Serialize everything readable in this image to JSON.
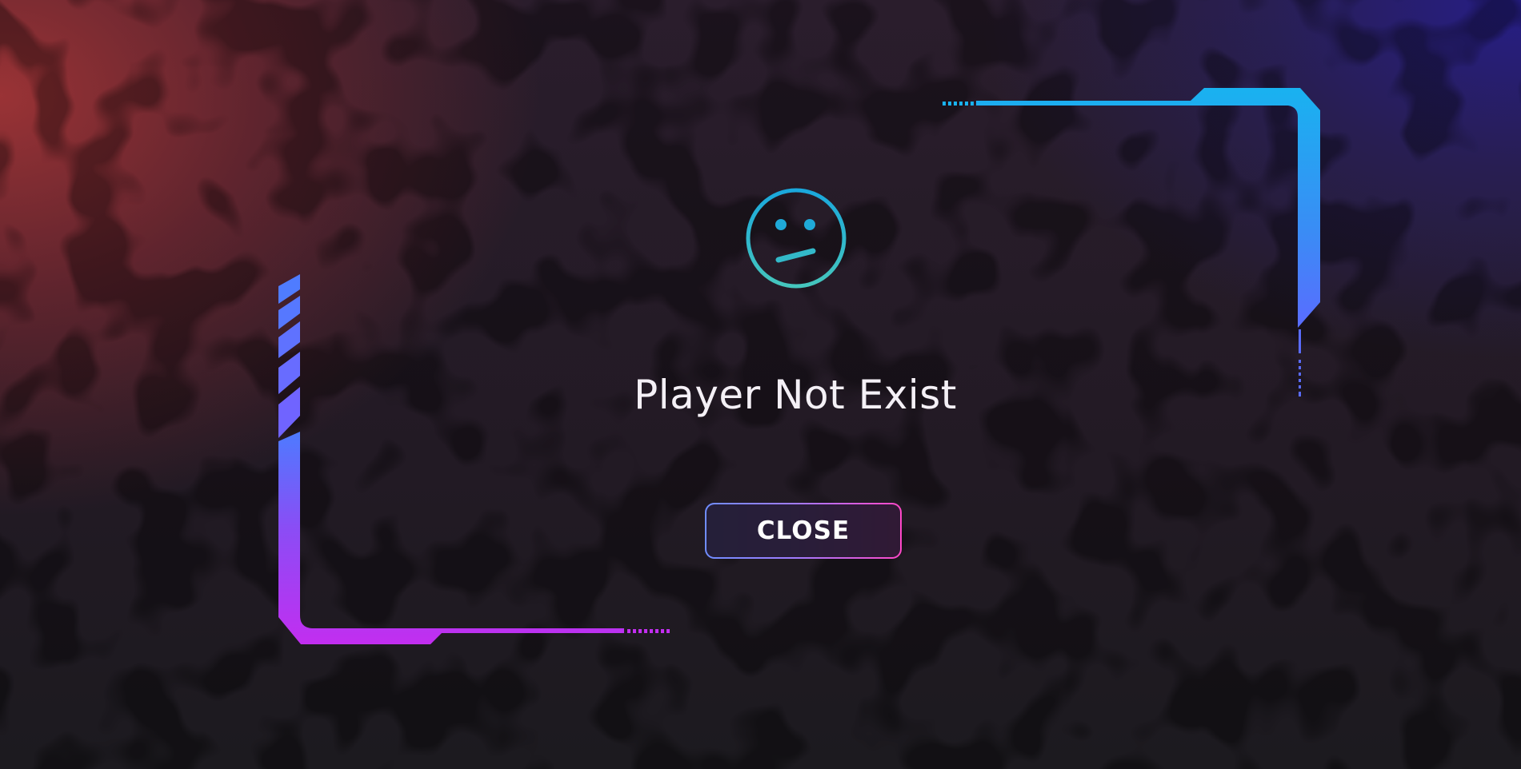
{
  "dialog": {
    "message": "Player Not Exist",
    "close_label": "CLOSE",
    "icon": "neutral-face-icon"
  },
  "colors": {
    "accent_cyan": "#1bb0f0",
    "accent_blue": "#4d7bff",
    "accent_purple": "#c02ef0",
    "accent_magenta": "#ff47c8",
    "face_cyan": "#22a9d8",
    "face_teal": "#3fc4c0"
  }
}
